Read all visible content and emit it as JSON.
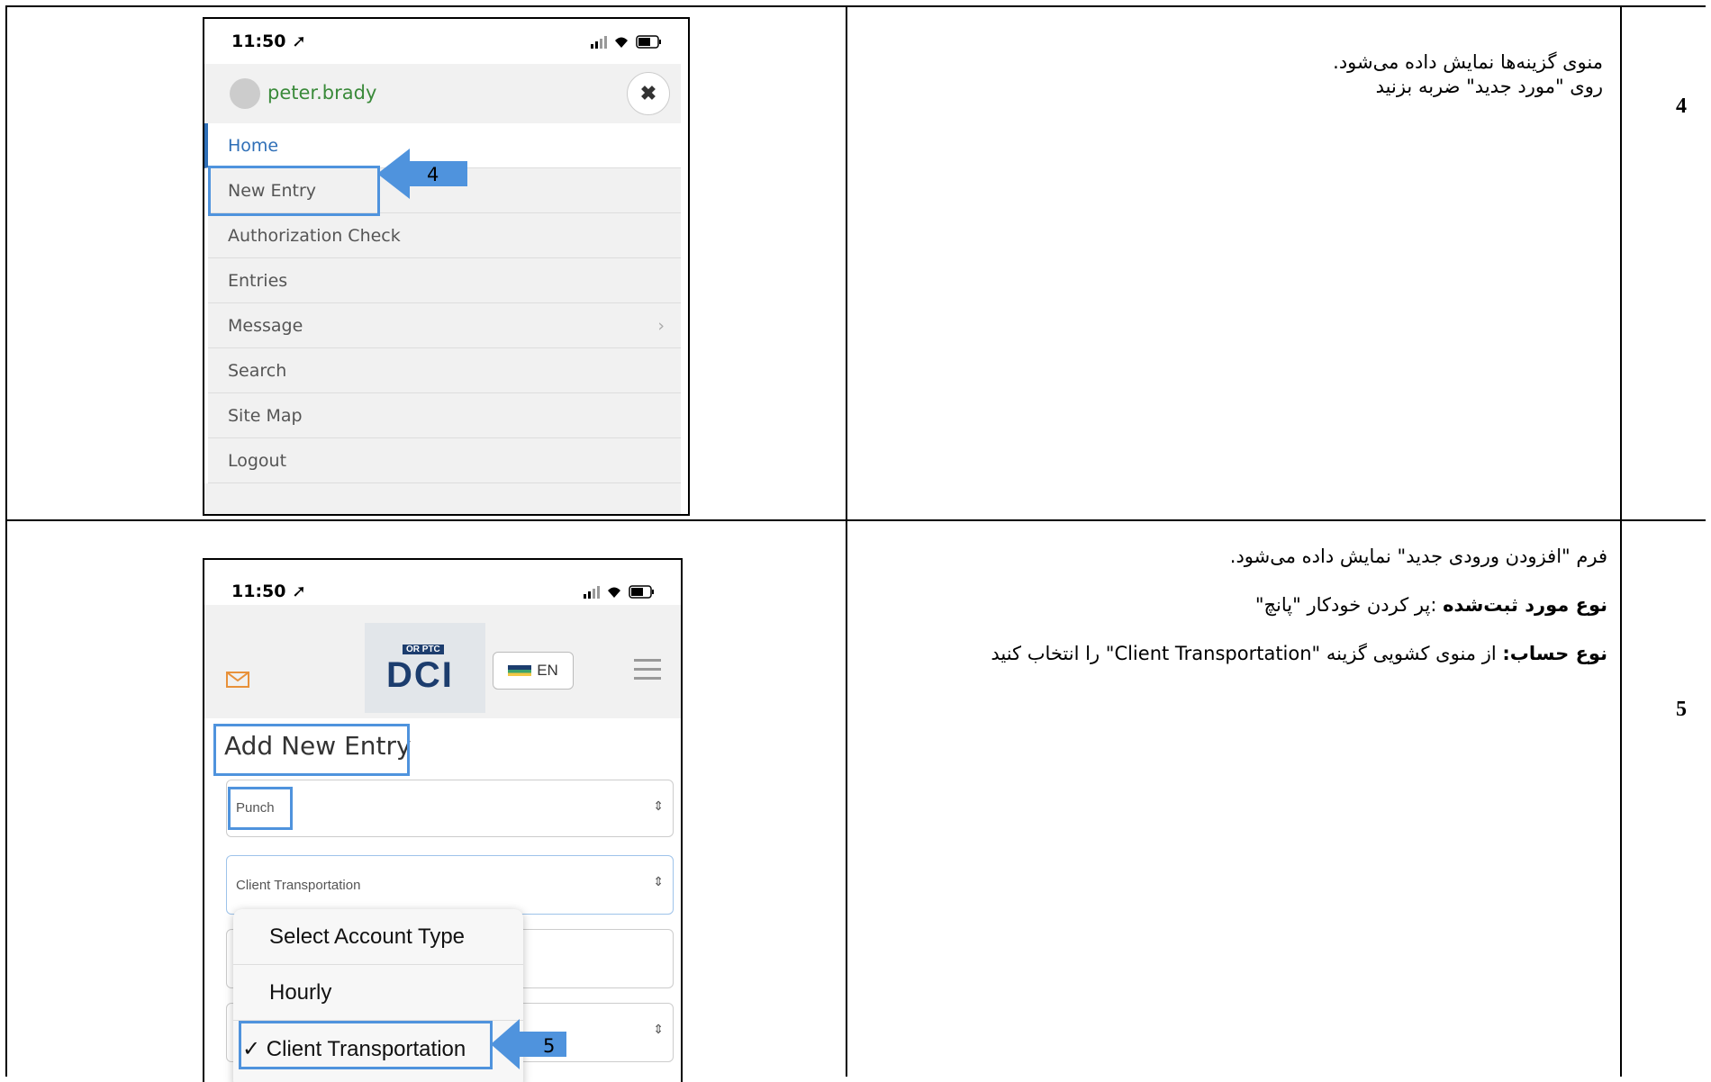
{
  "steps": [
    {
      "number": "4",
      "text_lines": [
        "منوی گزینه‌ها نمایش داده می‌شود.",
        "روی \"مورد جدید\" ضربه بزنید"
      ],
      "screenshot": {
        "time": "11:50",
        "username": "peter.brady",
        "menu_items": [
          "Home",
          "New Entry",
          "Authorization Check",
          "Entries",
          "Message",
          "Search",
          "Site Map",
          "Logout"
        ],
        "arrow_label": "4"
      }
    },
    {
      "number": "5",
      "intro": "فرم \"افزودن ورودی جدید\" نمایش داده می‌شود.",
      "entry_type_label": "نوع مورد ثبت‌شده",
      "entry_type_text": " :پر کردن خودکار \"پانچ\"",
      "account_type_label": "نوع حساب:",
      "account_type_text": " از منوی کشویی گزینه \"Client Transportation\" را انتخاب کنید",
      "screenshot": {
        "time": "11:50",
        "lang_label": "EN",
        "logo_top": "OR PTC",
        "logo_text": "DCI",
        "form_title": "Add New Entry",
        "entry_type_value": "Punch",
        "account_type_value": "Client Transportation",
        "dropdown_options": [
          "Select Account Type",
          "Hourly",
          "✓ Client Transportation"
        ],
        "arrow_label": "5"
      }
    }
  ],
  "colors": {
    "accent": "#4f93dd",
    "username": "#3a8a3a",
    "link": "#2f6fb7"
  }
}
